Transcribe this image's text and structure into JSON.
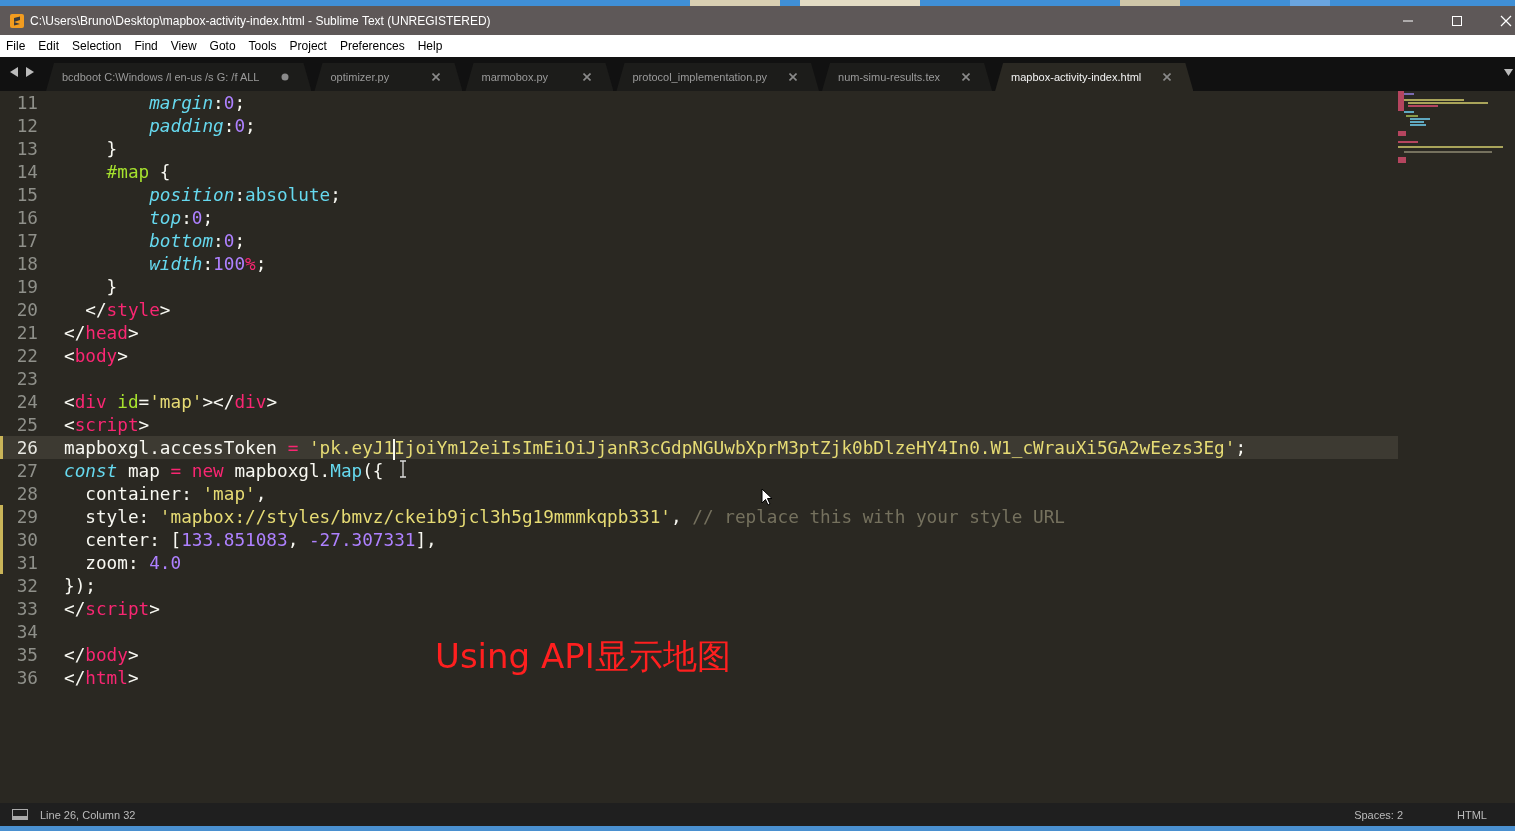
{
  "window": {
    "title": "C:\\Users\\Bruno\\Desktop\\mapbox-activity-index.html - Sublime Text (UNREGISTERED)"
  },
  "menu": [
    "File",
    "Edit",
    "Selection",
    "Find",
    "View",
    "Goto",
    "Tools",
    "Project",
    "Preferences",
    "Help"
  ],
  "tabs": [
    {
      "label": "bcdboot C:\\Windows /l en-us /s G: /f ALL",
      "selected": false,
      "dirty": true
    },
    {
      "label": "optimizer.py",
      "selected": false,
      "dirty": false
    },
    {
      "label": "marmobox.py",
      "selected": false,
      "dirty": false
    },
    {
      "label": "protocol_implementation.py",
      "selected": false,
      "dirty": false
    },
    {
      "label": "num-simu-results.tex",
      "selected": false,
      "dirty": false
    },
    {
      "label": "mapbox-activity-index.html",
      "selected": true,
      "dirty": false
    }
  ],
  "lines": [
    {
      "number": "11",
      "modified": false,
      "current": false,
      "tokens": [
        {
          "text": "        margin",
          "kind": "property"
        },
        {
          "text": ":",
          "kind": "plain"
        },
        {
          "text": "0",
          "kind": "number"
        },
        {
          "text": ";",
          "kind": "plain"
        }
      ]
    },
    {
      "number": "12",
      "modified": false,
      "current": false,
      "tokens": [
        {
          "text": "        padding",
          "kind": "property"
        },
        {
          "text": ":",
          "kind": "plain"
        },
        {
          "text": "0",
          "kind": "number"
        },
        {
          "text": ";",
          "kind": "plain"
        }
      ]
    },
    {
      "number": "13",
      "modified": false,
      "current": false,
      "tokens": [
        {
          "text": "    }",
          "kind": "plain"
        }
      ]
    },
    {
      "number": "14",
      "modified": false,
      "current": false,
      "tokens": [
        {
          "text": "    #map",
          "kind": "selector"
        },
        {
          "text": " {",
          "kind": "plain"
        }
      ]
    },
    {
      "number": "15",
      "modified": false,
      "current": false,
      "tokens": [
        {
          "text": "        position",
          "kind": "property"
        },
        {
          "text": ":",
          "kind": "plain"
        },
        {
          "text": "absolute",
          "kind": "value"
        },
        {
          "text": ";",
          "kind": "plain"
        }
      ]
    },
    {
      "number": "16",
      "modified": false,
      "current": false,
      "tokens": [
        {
          "text": "        top",
          "kind": "property"
        },
        {
          "text": ":",
          "kind": "plain"
        },
        {
          "text": "0",
          "kind": "number"
        },
        {
          "text": ";",
          "kind": "plain"
        }
      ]
    },
    {
      "number": "17",
      "modified": false,
      "current": false,
      "tokens": [
        {
          "text": "        bottom",
          "kind": "property"
        },
        {
          "text": ":",
          "kind": "plain"
        },
        {
          "text": "0",
          "kind": "number"
        },
        {
          "text": ";",
          "kind": "plain"
        }
      ]
    },
    {
      "number": "18",
      "modified": false,
      "current": false,
      "tokens": [
        {
          "text": "        width",
          "kind": "property"
        },
        {
          "text": ":",
          "kind": "plain"
        },
        {
          "text": "100",
          "kind": "number"
        },
        {
          "text": "%",
          "kind": "operator"
        },
        {
          "text": ";",
          "kind": "plain"
        }
      ]
    },
    {
      "number": "19",
      "modified": false,
      "current": false,
      "tokens": [
        {
          "text": "    }",
          "kind": "plain"
        }
      ]
    },
    {
      "number": "20",
      "modified": false,
      "current": false,
      "tokens": [
        {
          "text": "  </",
          "kind": "plain"
        },
        {
          "text": "style",
          "kind": "tag"
        },
        {
          "text": ">",
          "kind": "plain"
        }
      ]
    },
    {
      "number": "21",
      "modified": false,
      "current": false,
      "tokens": [
        {
          "text": "</",
          "kind": "plain"
        },
        {
          "text": "head",
          "kind": "tag"
        },
        {
          "text": ">",
          "kind": "plain"
        }
      ]
    },
    {
      "number": "22",
      "modified": false,
      "current": false,
      "tokens": [
        {
          "text": "<",
          "kind": "plain"
        },
        {
          "text": "body",
          "kind": "tag"
        },
        {
          "text": ">",
          "kind": "plain"
        }
      ]
    },
    {
      "number": "23",
      "modified": false,
      "current": false
    },
    {
      "number": "24",
      "modified": false,
      "current": false,
      "tokens": [
        {
          "text": "<",
          "kind": "plain"
        },
        {
          "text": "div",
          "kind": "tag"
        },
        {
          "text": " id",
          "kind": "attribute"
        },
        {
          "text": "=",
          "kind": "plain"
        },
        {
          "text": "'map'",
          "kind": "string"
        },
        {
          "text": "></",
          "kind": "plain"
        },
        {
          "text": "div",
          "kind": "tag"
        },
        {
          "text": ">",
          "kind": "plain"
        }
      ]
    },
    {
      "number": "25",
      "modified": false,
      "current": false,
      "tokens": [
        {
          "text": "<",
          "kind": "plain"
        },
        {
          "text": "script",
          "kind": "tag"
        },
        {
          "text": ">",
          "kind": "plain"
        }
      ]
    },
    {
      "number": "26",
      "modified": true,
      "current": true,
      "tokens": [
        {
          "text": "mapboxgl.accessToken",
          "kind": "plain"
        },
        {
          "text": " = ",
          "kind": "operator"
        },
        {
          "text": "'pk.eyJ1",
          "kind": "string",
          "caret": true
        },
        {
          "text": "IjoiYm12eiIsImEiOiJjanR3cGdpNGUwbXprM3ptZjk0bDlzeHY4In0.W1_cWrauXi5GA2wEezs3Eg'",
          "kind": "string"
        },
        {
          "text": ";",
          "kind": "plain"
        }
      ]
    },
    {
      "number": "27",
      "modified": false,
      "current": false,
      "tokens": [
        {
          "text": "const",
          "kind": "storage"
        },
        {
          "text": " map ",
          "kind": "plain"
        },
        {
          "text": "= ",
          "kind": "operator"
        },
        {
          "text": "new",
          "kind": "keyword"
        },
        {
          "text": " mapboxgl.",
          "kind": "plain"
        },
        {
          "text": "Map",
          "kind": "function"
        },
        {
          "text": "({",
          "kind": "plain"
        }
      ]
    },
    {
      "number": "28",
      "modified": false,
      "current": false,
      "tokens": [
        {
          "text": "  container: ",
          "kind": "plain"
        },
        {
          "text": "'map'",
          "kind": "string"
        },
        {
          "text": ",",
          "kind": "plain"
        }
      ]
    },
    {
      "number": "29",
      "modified": true,
      "current": false,
      "tokens": [
        {
          "text": "  style: ",
          "kind": "plain"
        },
        {
          "text": "'mapbox://styles/bmvz/ckeib9jcl3h5g19mmmkqpb331'",
          "kind": "string"
        },
        {
          "text": ", ",
          "kind": "plain"
        },
        {
          "text": "// replace this with your style URL",
          "kind": "comment"
        }
      ]
    },
    {
      "number": "30",
      "modified": true,
      "current": false,
      "tokens": [
        {
          "text": "  center: [",
          "kind": "plain"
        },
        {
          "text": "133.851083",
          "kind": "number"
        },
        {
          "text": ", ",
          "kind": "plain"
        },
        {
          "text": "-27.307331",
          "kind": "number"
        },
        {
          "text": "],",
          "kind": "plain"
        }
      ]
    },
    {
      "number": "31",
      "modified": true,
      "current": false,
      "tokens": [
        {
          "text": "  zoom: ",
          "kind": "plain"
        },
        {
          "text": "4.0",
          "kind": "number"
        }
      ]
    },
    {
      "number": "32",
      "modified": false,
      "current": false,
      "tokens": [
        {
          "text": "});",
          "kind": "plain"
        }
      ]
    },
    {
      "number": "33",
      "modified": false,
      "current": false,
      "tokens": [
        {
          "text": "</",
          "kind": "plain"
        },
        {
          "text": "script",
          "kind": "tag"
        },
        {
          "text": ">",
          "kind": "plain"
        }
      ]
    },
    {
      "number": "34",
      "modified": false,
      "current": false
    },
    {
      "number": "35",
      "modified": false,
      "current": false,
      "tokens": [
        {
          "text": "</",
          "kind": "plain"
        },
        {
          "text": "body",
          "kind": "tag"
        },
        {
          "text": ">",
          "kind": "plain"
        }
      ]
    },
    {
      "number": "36",
      "modified": false,
      "current": false,
      "tokens": [
        {
          "text": "</",
          "kind": "plain"
        },
        {
          "text": "html",
          "kind": "tag"
        },
        {
          "text": ">",
          "kind": "plain"
        }
      ]
    }
  ],
  "overlay_caption": "Using API显示地图",
  "status_bar": {
    "position": "Line 26, Column 32",
    "indentation": "Spaces: 2",
    "syntax": "HTML"
  }
}
